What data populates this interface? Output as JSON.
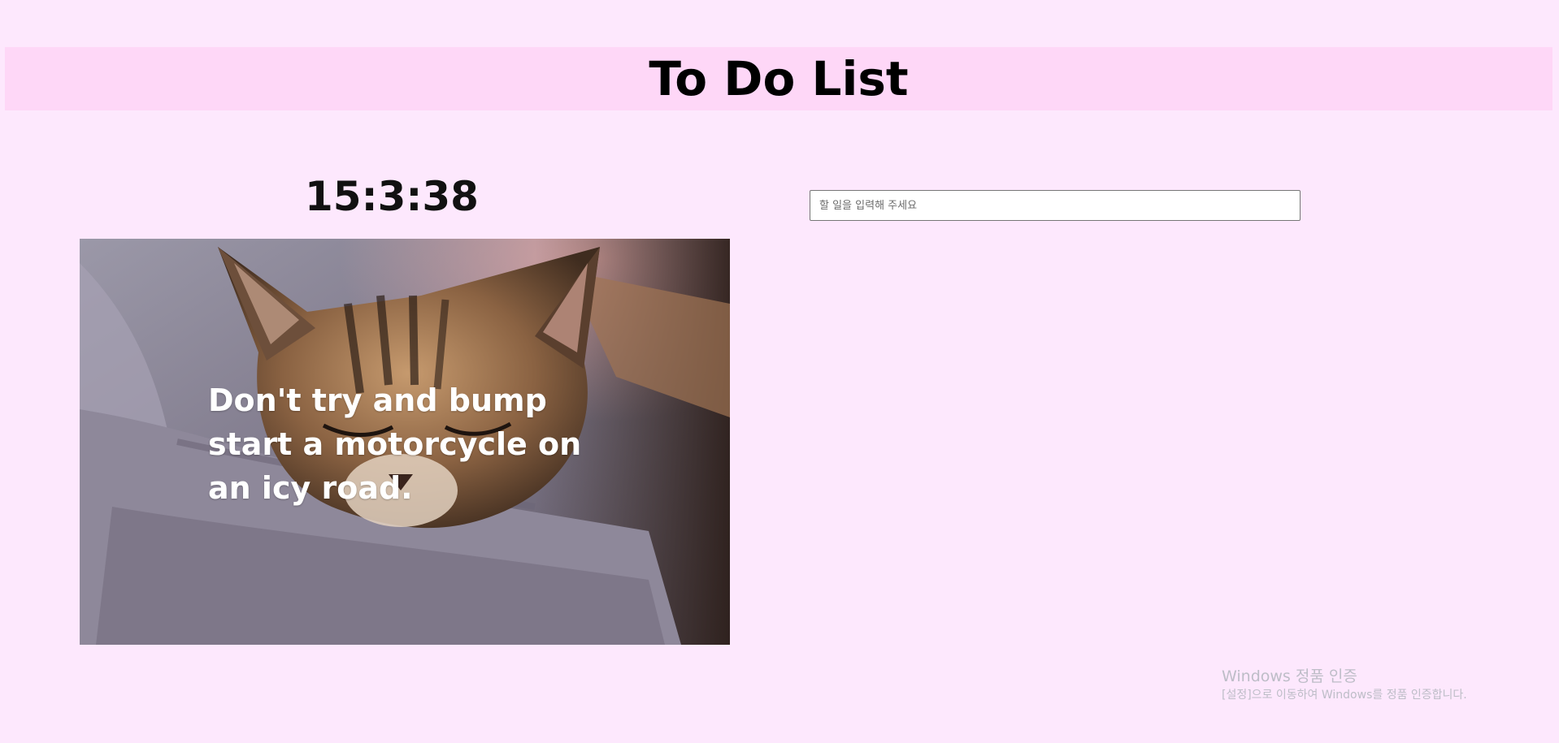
{
  "header": {
    "title": "To Do List"
  },
  "clock": {
    "time": "15:3:38"
  },
  "photo": {
    "subject": "sleeping tabby cat on grey blanket",
    "quote": "Don't try and bump start a motorcycle on an icy road."
  },
  "todo": {
    "input_placeholder": "할 일을 입력해 주세요",
    "input_value": "",
    "items": []
  },
  "watermark": {
    "title": "Windows 정품 인증",
    "subtitle": "[설정]으로 이동하여 Windows를 정품 인증합니다."
  },
  "colors": {
    "page_background": "#fde8fd",
    "header_background": "#fed7f7",
    "quote_text": "#ffffff"
  }
}
